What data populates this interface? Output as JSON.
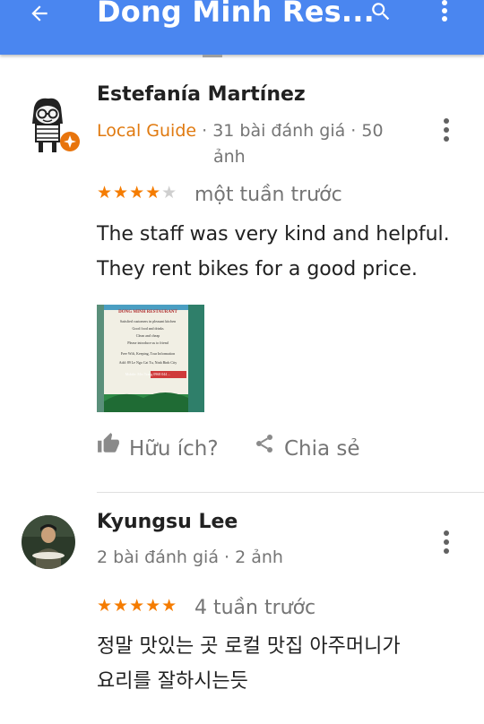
{
  "appbar": {
    "title": "Dong Minh Res...",
    "back_icon": "arrow-back-icon",
    "search_icon": "search-icon",
    "more_icon": "more-vert-icon",
    "color": "#4a86f0"
  },
  "reviews": [
    {
      "author": "Estefanía Martínez",
      "badge": "Local Guide",
      "meta_line1": " · 31 bài đánh giá · 50",
      "meta_line2": "ảnh",
      "rating": 4,
      "stars_on": "★★★★",
      "stars_off": "★",
      "time": "một tuần trước",
      "text_line1": "The staff was very kind and helpful.",
      "text_line2": "They rent bikes for a good price.",
      "photo_sign": {
        "heading": "DONG MINH RESTAURANT",
        "lines": [
          "Satisfied customers in pleasant kitchen",
          "Good food and drinks",
          "Clean and cheap",
          "Please introduce us to friend",
          "Free Wifi, Keeping, Tour Information",
          "Add: 89 Le Ngo Cat Tu, Ninh Binh City"
        ],
        "phone": "Mobile: Mrs Trang 0968 044 ..."
      },
      "helpful_label": "Hữu ích?",
      "share_label": "Chia sẻ"
    },
    {
      "author": "Kyungsu Lee",
      "meta_line1": "2 bài đánh giá · 2 ảnh",
      "rating": 5,
      "stars_on": "★★★★★",
      "time": "4 tuần trước",
      "text_line1": "정말 맛있는 곳 로컬 맛집 아주머니가",
      "text_line2": "요리를 잘하시는듯"
    }
  ],
  "colors": {
    "local_guide": "#e07a10",
    "star": "#f57c00",
    "muted": "#757575"
  }
}
